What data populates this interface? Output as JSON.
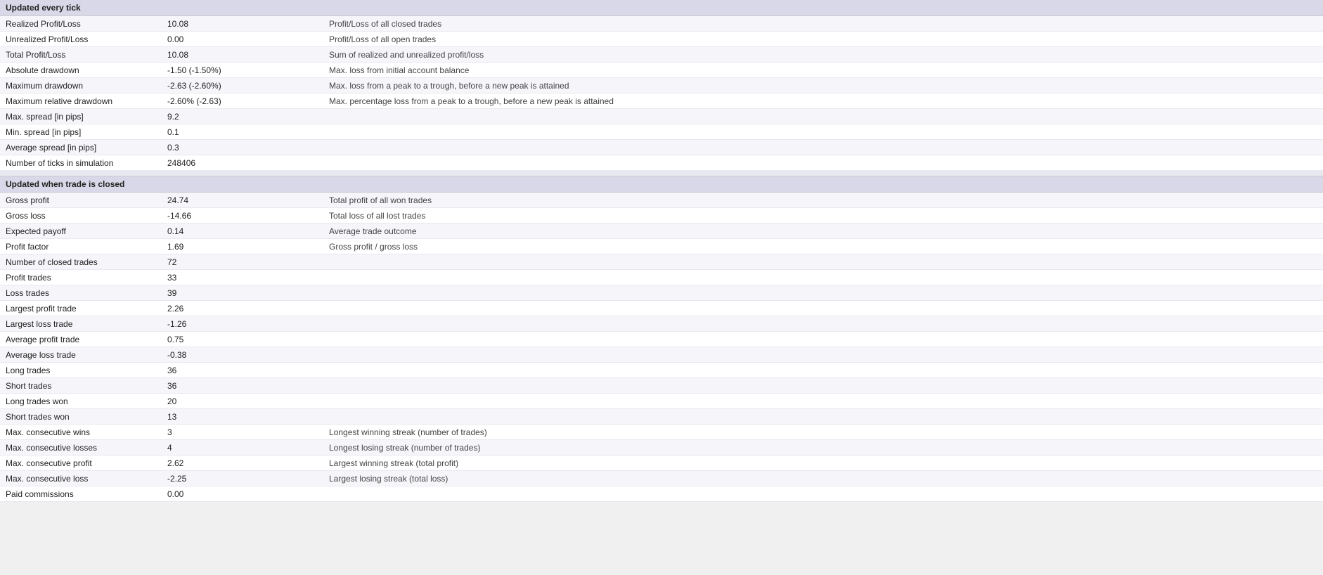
{
  "sections": [
    {
      "id": "updated-every-tick",
      "header": "Updated every tick",
      "rows": [
        {
          "label": "Realized Profit/Loss",
          "value": "10.08",
          "desc": "Profit/Loss of all closed trades"
        },
        {
          "label": "Unrealized Profit/Loss",
          "value": "0.00",
          "desc": "Profit/Loss of all open trades"
        },
        {
          "label": "Total Profit/Loss",
          "value": "10.08",
          "desc": "Sum of realized and unrealized profit/loss"
        },
        {
          "label": "Absolute drawdown",
          "value": "-1.50 (-1.50%)",
          "desc": "Max. loss from initial account balance"
        },
        {
          "label": "Maximum drawdown",
          "value": "-2.63 (-2.60%)",
          "desc": "Max. loss from a peak to a trough, before a new peak is attained"
        },
        {
          "label": "Maximum relative drawdown",
          "value": "-2.60% (-2.63)",
          "desc": "Max. percentage loss from a peak to a trough, before a new peak is attained"
        },
        {
          "label": "Max. spread [in pips]",
          "value": "9.2",
          "desc": ""
        },
        {
          "label": "Min. spread [in pips]",
          "value": "0.1",
          "desc": ""
        },
        {
          "label": "Average spread [in pips]",
          "value": "0.3",
          "desc": ""
        },
        {
          "label": "Number of ticks in simulation",
          "value": "248406",
          "desc": ""
        }
      ]
    },
    {
      "id": "updated-when-trade-closed",
      "header": "Updated when trade is closed",
      "rows": [
        {
          "label": "Gross profit",
          "value": "24.74",
          "desc": "Total profit of all won trades"
        },
        {
          "label": "Gross loss",
          "value": "-14.66",
          "desc": "Total loss of all lost trades"
        },
        {
          "label": "Expected payoff",
          "value": "0.14",
          "desc": "Average trade outcome"
        },
        {
          "label": "Profit factor",
          "value": "1.69",
          "desc": "Gross profit / gross loss"
        },
        {
          "label": "Number of closed trades",
          "value": "72",
          "desc": ""
        },
        {
          "label": "Profit trades",
          "value": "33",
          "desc": ""
        },
        {
          "label": "Loss trades",
          "value": "39",
          "desc": ""
        },
        {
          "label": "Largest profit trade",
          "value": "2.26",
          "desc": ""
        },
        {
          "label": "Largest loss trade",
          "value": "-1.26",
          "desc": ""
        },
        {
          "label": "Average profit trade",
          "value": "0.75",
          "desc": ""
        },
        {
          "label": "Average loss trade",
          "value": "-0.38",
          "desc": ""
        },
        {
          "label": "Long trades",
          "value": "36",
          "desc": ""
        },
        {
          "label": "Short trades",
          "value": "36",
          "desc": ""
        },
        {
          "label": "Long trades won",
          "value": "20",
          "desc": ""
        },
        {
          "label": "Short trades won",
          "value": "13",
          "desc": ""
        },
        {
          "label": "Max. consecutive wins",
          "value": "3",
          "desc": "Longest winning streak (number of trades)"
        },
        {
          "label": "Max. consecutive losses",
          "value": "4",
          "desc": "Longest losing streak (number of trades)"
        },
        {
          "label": "Max. consecutive profit",
          "value": "2.62",
          "desc": "Largest winning streak (total profit)"
        },
        {
          "label": "Max. consecutive loss",
          "value": "-2.25",
          "desc": "Largest losing streak (total loss)"
        },
        {
          "label": "Paid commissions",
          "value": "0.00",
          "desc": ""
        }
      ]
    }
  ]
}
